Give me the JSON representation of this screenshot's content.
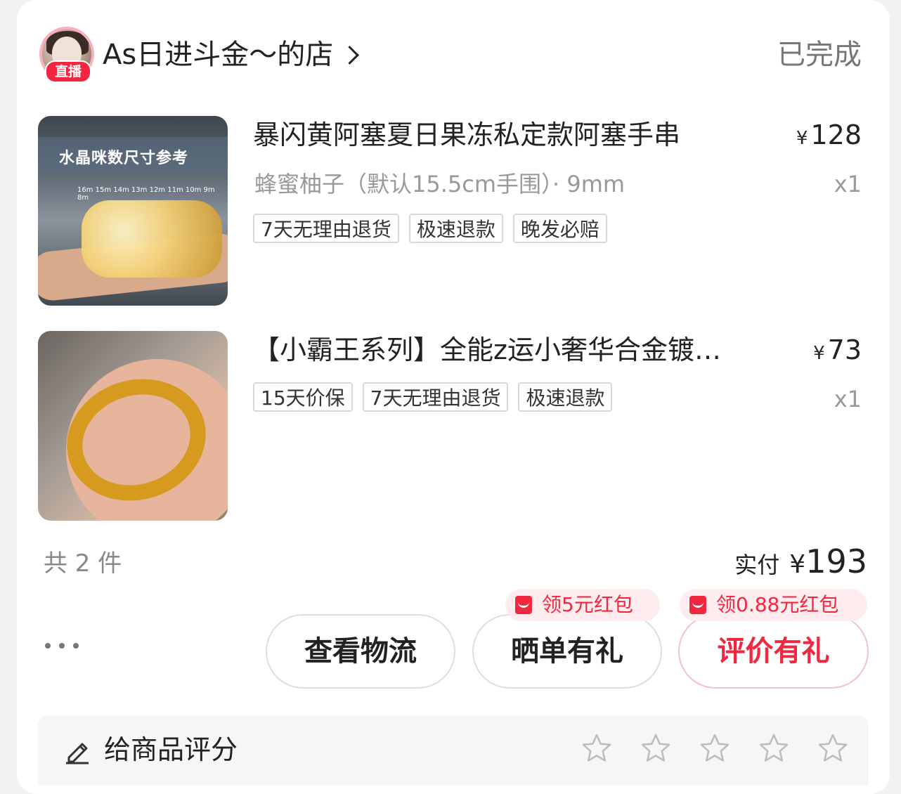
{
  "shop": {
    "name": "As日进斗金～的店",
    "live_badge": "直播",
    "status": "已完成"
  },
  "items": [
    {
      "title": "暴闪黄阿塞夏日果冻私定款阿塞手串",
      "spec": "蜂蜜柚子（默认15.5cm手围）· 9mm",
      "currency": "¥",
      "price": "128",
      "qty": "x1",
      "image_label": "水晶咪数尺寸参考",
      "image_sizes": "16m 15m 14m 13m 12m 11m 10m 9m 8m",
      "tags": [
        "7天无理由退货",
        "极速退款",
        "晚发必赔"
      ]
    },
    {
      "title": "【小霸王系列】全能z运小奢华合金镀…",
      "currency": "¥",
      "price": "73",
      "qty": "x1",
      "tags": [
        "15天价保",
        "7天无理由退货",
        "极速退款"
      ]
    }
  ],
  "summary": {
    "count": "共 2 件",
    "paid_label": "实付",
    "paid_currency": "¥",
    "paid_amount": "193"
  },
  "actions": {
    "logistics": "查看物流",
    "share": "晒单有礼",
    "review": "评价有礼",
    "coupon_share": "领5元红包",
    "coupon_review": "领0.88元红包"
  },
  "rating": {
    "label": "给商品评分",
    "max_stars": 5,
    "value": 0
  },
  "colors": {
    "accent": "#f0273f",
    "coupon_bg": "#ffecef",
    "muted": "#999999"
  }
}
